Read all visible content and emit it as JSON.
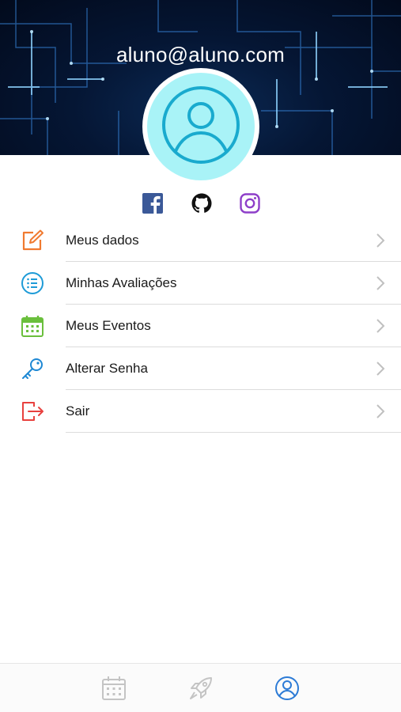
{
  "header": {
    "email": "aluno@aluno.com"
  },
  "social": {
    "icons": [
      "facebook-icon",
      "github-icon",
      "instagram-icon"
    ],
    "colors": {
      "facebook": "#3b5998",
      "github": "#111111",
      "instagram": "#8e3fc9"
    }
  },
  "menu": {
    "items": [
      {
        "label": "Meus dados",
        "icon": "edit-icon",
        "color": "#f07a30"
      },
      {
        "label": "Minhas Avaliações",
        "icon": "list-icon",
        "color": "#1e9bd7"
      },
      {
        "label": "Meus Eventos",
        "icon": "calendar-icon",
        "color": "#6abf3c"
      },
      {
        "label": "Alterar Senha",
        "icon": "key-icon",
        "color": "#1e88d4"
      },
      {
        "label": "Sair",
        "icon": "logout-icon",
        "color": "#e8413e"
      }
    ]
  },
  "tabbar": {
    "tabs": [
      {
        "icon": "calendar-icon",
        "active": false
      },
      {
        "icon": "rocket-icon",
        "active": false
      },
      {
        "icon": "profile-icon",
        "active": true
      }
    ],
    "active_color": "#2d7bd6",
    "inactive_color": "#c4c4c4"
  },
  "avatar": {
    "background": "#a9f3f7",
    "icon": "user-icon",
    "color": "#1ab0d0"
  }
}
